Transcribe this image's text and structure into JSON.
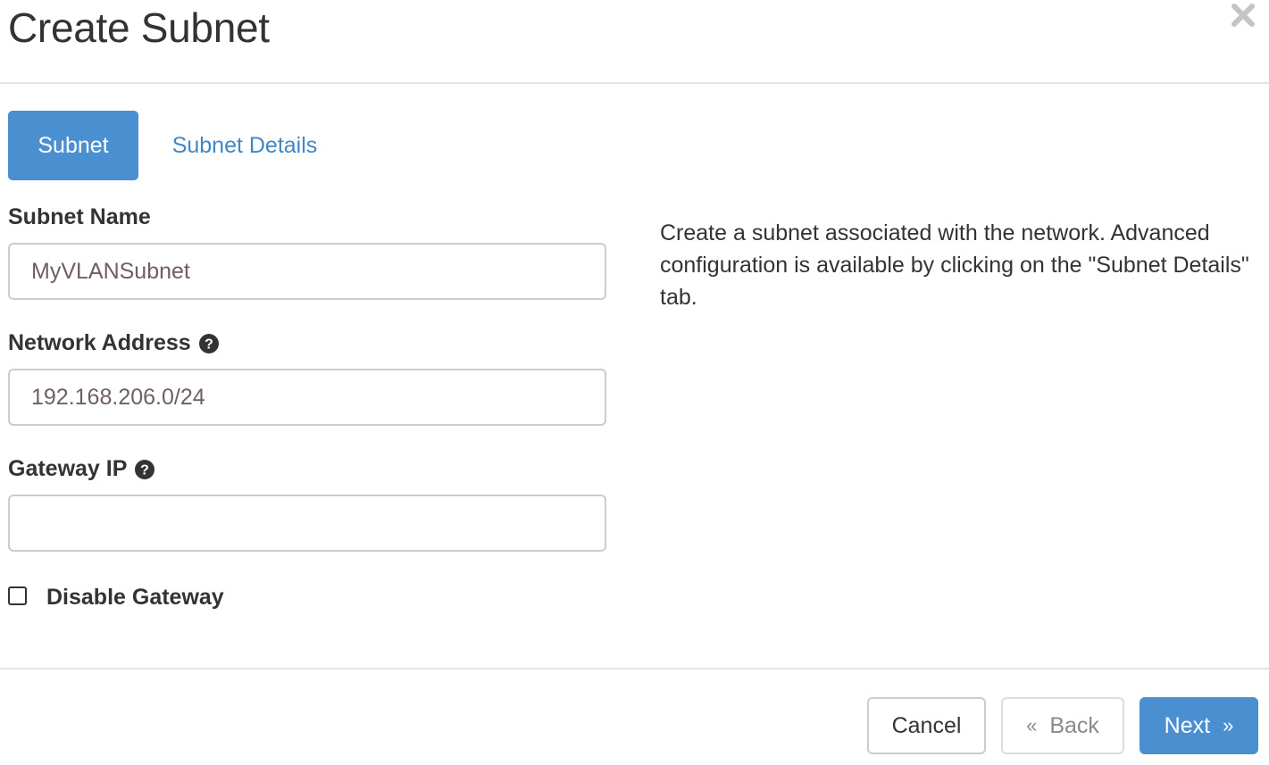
{
  "modal": {
    "title": "Create Subnet",
    "close_icon": "close-icon"
  },
  "tabs": [
    {
      "label": "Subnet",
      "active": true
    },
    {
      "label": "Subnet Details",
      "active": false
    }
  ],
  "form": {
    "subnet_name": {
      "label": "Subnet Name",
      "value": "MyVLANSubnet"
    },
    "network_address": {
      "label": "Network Address",
      "value": "192.168.206.0/24",
      "help_icon": "question-circle-icon"
    },
    "gateway_ip": {
      "label": "Gateway IP",
      "value": "",
      "help_icon": "question-circle-icon"
    },
    "disable_gateway": {
      "label": "Disable Gateway",
      "checked": false
    }
  },
  "help_text": "Create a subnet associated with the network. Advanced configuration is available by clicking on the \"Subnet Details\" tab.",
  "footer": {
    "cancel_label": "Cancel",
    "back_label": "Back",
    "back_icon": "«",
    "next_label": "Next",
    "next_icon": "»"
  },
  "colors": {
    "primary": "#4a8fd0",
    "link": "#3f87c6",
    "text": "#333333",
    "border": "#cccccc"
  }
}
